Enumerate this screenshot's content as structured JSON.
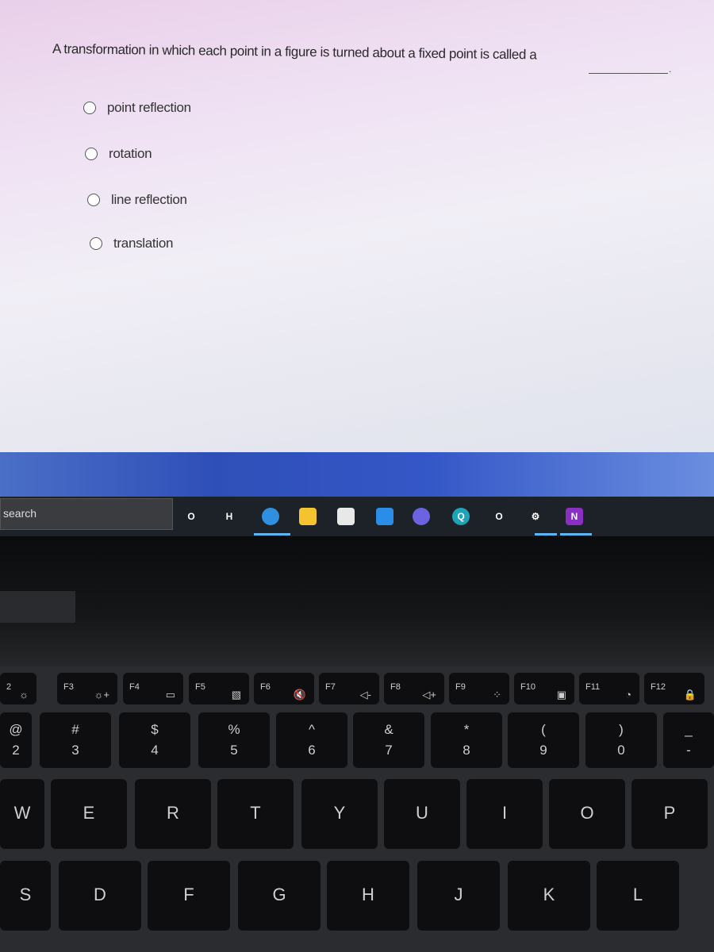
{
  "question": {
    "text": "A transformation in which each point in a figure is turned about a fixed point is called a",
    "suffix": "."
  },
  "options": [
    {
      "label": "point reflection"
    },
    {
      "label": "rotation"
    },
    {
      "label": "line reflection"
    },
    {
      "label": "translation"
    }
  ],
  "taskbar": {
    "search_label": "search",
    "icons": [
      {
        "name": "cortana-circle-icon",
        "color": "#1d2128",
        "glyph": "O"
      },
      {
        "name": "task-view-icon",
        "color": "#1d2128",
        "glyph": "H"
      },
      {
        "name": "edge-browser-icon",
        "color": "#2f8fe0",
        "glyph": ""
      },
      {
        "name": "file-explorer-icon",
        "color": "#f4c430",
        "glyph": ""
      },
      {
        "name": "microsoft-store-icon",
        "color": "#e8e8e8",
        "glyph": ""
      },
      {
        "name": "mail-icon",
        "color": "#2a8ee8",
        "glyph": ""
      },
      {
        "name": "app-purple-icon",
        "color": "#6b63e0",
        "glyph": ""
      },
      {
        "name": "search-app-icon",
        "color": "#1fa3b8",
        "glyph": "Q"
      },
      {
        "name": "alexa-ring-icon",
        "color": "#1d2128",
        "glyph": "O"
      },
      {
        "name": "settings-gear-icon",
        "color": "#1d2128",
        "glyph": "⚙"
      },
      {
        "name": "onenote-icon",
        "color": "#8a2fc4",
        "glyph": "N"
      }
    ]
  },
  "keyboard": {
    "function_row": [
      {
        "label": "2",
        "icon": "☼"
      },
      {
        "label": "F3",
        "icon": "☼+"
      },
      {
        "label": "F4",
        "icon": "▭"
      },
      {
        "label": "F5",
        "icon": "▧"
      },
      {
        "label": "F6",
        "icon": "🔇"
      },
      {
        "label": "F7",
        "icon": "◁-"
      },
      {
        "label": "F8",
        "icon": "◁+"
      },
      {
        "label": "F9",
        "icon": "⁘"
      },
      {
        "label": "F10",
        "icon": "▣"
      },
      {
        "label": "F11",
        "icon": "◔"
      },
      {
        "label": "F12",
        "icon": "🔒"
      }
    ],
    "number_row": [
      {
        "top": "@",
        "bottom": "2"
      },
      {
        "top": "#",
        "bottom": "3"
      },
      {
        "top": "$",
        "bottom": "4"
      },
      {
        "top": "%",
        "bottom": "5"
      },
      {
        "top": "^",
        "bottom": "6"
      },
      {
        "top": "&",
        "bottom": "7"
      },
      {
        "top": "*",
        "bottom": "8"
      },
      {
        "top": "(",
        "bottom": "9"
      },
      {
        "top": ")",
        "bottom": "0"
      },
      {
        "top": "_",
        "bottom": "-"
      }
    ],
    "qwerty_row": [
      "W",
      "E",
      "R",
      "T",
      "Y",
      "U",
      "I",
      "O",
      "P"
    ],
    "home_row": [
      "S",
      "D",
      "F",
      "G",
      "H",
      "J",
      "K",
      "L"
    ]
  }
}
